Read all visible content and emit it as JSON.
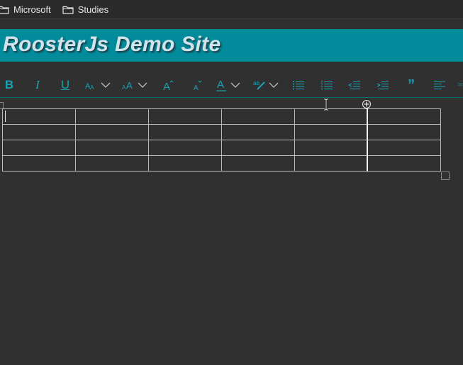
{
  "bookmarks": {
    "items": [
      {
        "label": "Microsoft",
        "icon": "folder-icon"
      },
      {
        "label": "Studies",
        "icon": "folder-icon"
      }
    ]
  },
  "banner": {
    "title": "RoosterJs Demo Site",
    "color": "#028b9b"
  },
  "toolbar": {
    "accent": "#1aa2b3",
    "buttons": [
      {
        "name": "bold",
        "icon": "bold-icon",
        "glyph": "B"
      },
      {
        "name": "italic",
        "icon": "italic-icon",
        "glyph": "I"
      },
      {
        "name": "underline",
        "icon": "underline-icon",
        "glyph": "U"
      },
      {
        "name": "font-name",
        "icon": "font-name-icon"
      },
      {
        "name": "font-size",
        "icon": "font-size-icon"
      },
      {
        "name": "increase-font-size",
        "icon": "increase-font-icon"
      },
      {
        "name": "decrease-font-size",
        "icon": "decrease-font-icon"
      },
      {
        "name": "text-color",
        "icon": "text-color-icon"
      },
      {
        "name": "highlight",
        "icon": "highlight-icon"
      },
      {
        "name": "bullets",
        "icon": "bullet-list-icon"
      },
      {
        "name": "numbering",
        "icon": "numbered-list-icon"
      },
      {
        "name": "decrease-indent",
        "icon": "outdent-icon"
      },
      {
        "name": "increase-indent",
        "icon": "indent-icon"
      },
      {
        "name": "quote",
        "icon": "quote-icon",
        "glyph": "”"
      },
      {
        "name": "align-left",
        "icon": "align-left-icon"
      }
    ]
  },
  "editor": {
    "table": {
      "rows": 4,
      "columns": 6
    }
  }
}
